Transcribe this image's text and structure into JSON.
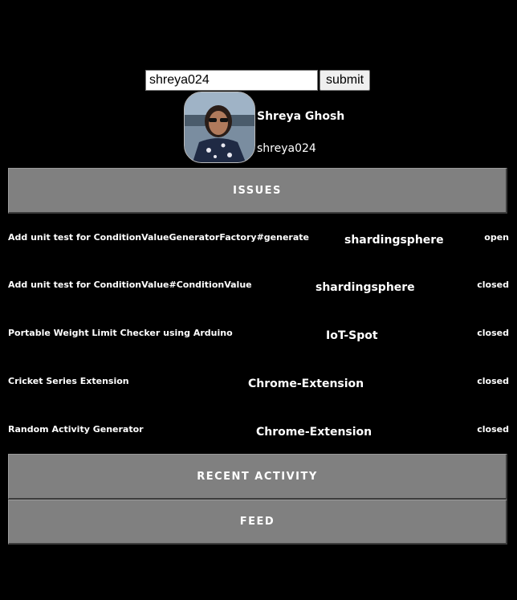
{
  "search": {
    "value": "shreya024",
    "submit_label": "submit"
  },
  "profile": {
    "name": "Shreya Ghosh",
    "username": "shreya024"
  },
  "sections": {
    "issues": "ISSUES",
    "recent_activity": "RECENT ACTIVITY",
    "feed": "FEED"
  },
  "issues": [
    {
      "title": "Add unit test for ConditionValueGeneratorFactory#generate",
      "repo": "shardingsphere",
      "state": "open"
    },
    {
      "title": "Add unit test for ConditionValue#ConditionValue",
      "repo": "shardingsphere",
      "state": "closed"
    },
    {
      "title": "Portable Weight Limit Checker using Arduino",
      "repo": "IoT-Spot",
      "state": "closed"
    },
    {
      "title": "Cricket Series Extension",
      "repo": "Chrome-Extension",
      "state": "closed"
    },
    {
      "title": "Random Activity Generator",
      "repo": "Chrome-Extension",
      "state": "closed"
    }
  ]
}
